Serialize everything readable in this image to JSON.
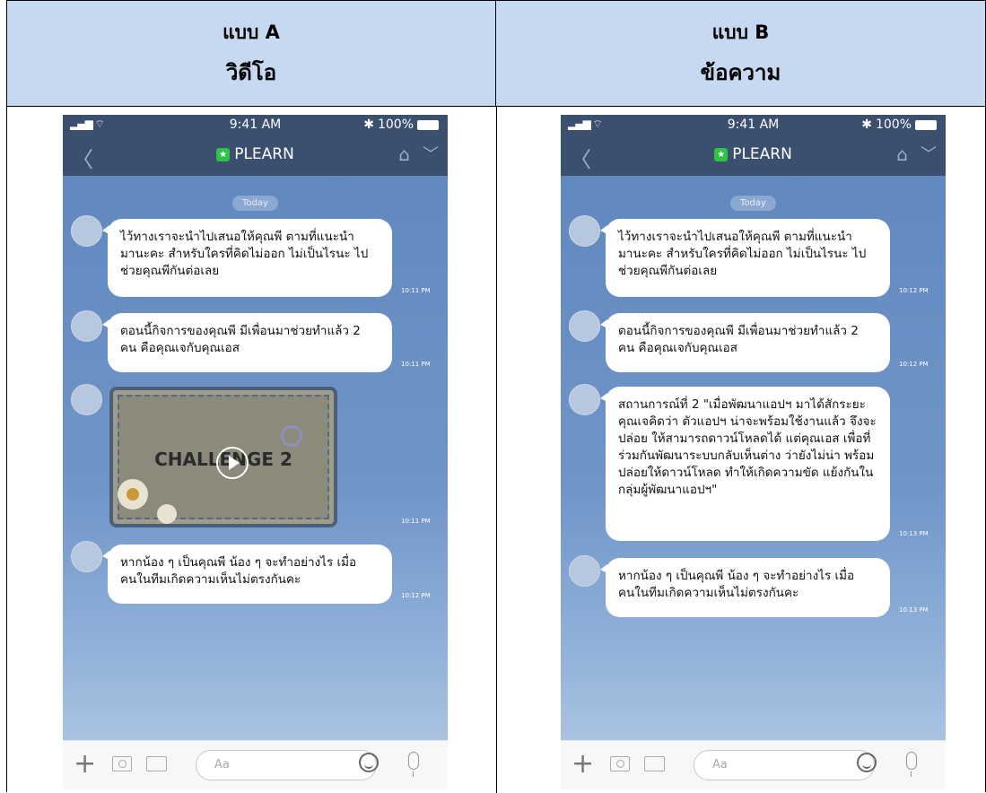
{
  "header": {
    "col_a_label": "แบบ A",
    "col_a_title": "วิดีโอ",
    "col_b_label": "แบบ B",
    "col_b_title": "ข้อความ"
  },
  "phone": {
    "time": "9:41 AM",
    "battery": "100%",
    "title": "PLEARN",
    "date_pill": "Today",
    "input_placeholder": "Aa"
  },
  "screen_a": {
    "messages": [
      {
        "text": "ไว้ทางเราจะนำไปเสนอให้คุณพี ตามที่แนะนำ มานะคะ สำหรับใครที่คิดไม่ออก ไม่เป็นไรนะ ไปช่วยคุณพีกันต่อเลย",
        "time": "10:11 PM"
      },
      {
        "text": "ตอนนี้กิจการของคุณพี มีเพื่อนมาช่วยทำแล้ว 2 คน คือคุณเจกับคุณเอส",
        "time": "10:11 PM"
      },
      {
        "video_caption": "CHALLENGE 2",
        "time": "10:11 PM"
      },
      {
        "text": "หากน้อง ๆ เป็นคุณพี น้อง ๆ จะทำอย่างไร เมื่อ คนในทีมเกิดความเห็นไม่ตรงกันคะ",
        "time": "10:12 PM"
      }
    ]
  },
  "screen_b": {
    "messages": [
      {
        "text": "ไว้ทางเราจะนำไปเสนอให้คุณพี ตามที่แนะนำ มานะคะ สำหรับใครที่คิดไม่ออก ไม่เป็นไรนะ ไปช่วยคุณพีกันต่อเลย",
        "time": "10:12 PM"
      },
      {
        "text": "ตอนนี้กิจการของคุณพี มีเพื่อนมาช่วยทำแล้ว 2 คน คือคุณเจกับคุณเอส",
        "time": "10:12 PM"
      },
      {
        "text": "สถานการณ์ที่ 2 \"เมื่อพัฒนาแอปฯ มาได้สักระยะ คุณเจคิดว่า ตัวแอปฯ น่าจะพร้อมใช้งานแล้ว จึงจะปล่อย ให้สามารถดาวน์โหลดได้ แต่คุณเอส เพื่อที่ ร่วมกันพัฒนาระบบกลับเห็นต่าง ว่ายังไม่น่า พร้อมปล่อยให้ดาวน์โหลด ทำให้เกิดความขัด แย้งกันในกลุ่มผู้พัฒนาแอปฯ\"",
        "time": "10:13 PM"
      },
      {
        "text": "หากน้อง ๆ เป็นคุณพี น้อง ๆ จะทำอย่างไร เมื่อ คนในทีมเกิดความเห็นไม่ตรงกันคะ",
        "time": "10:13 PM"
      }
    ]
  }
}
